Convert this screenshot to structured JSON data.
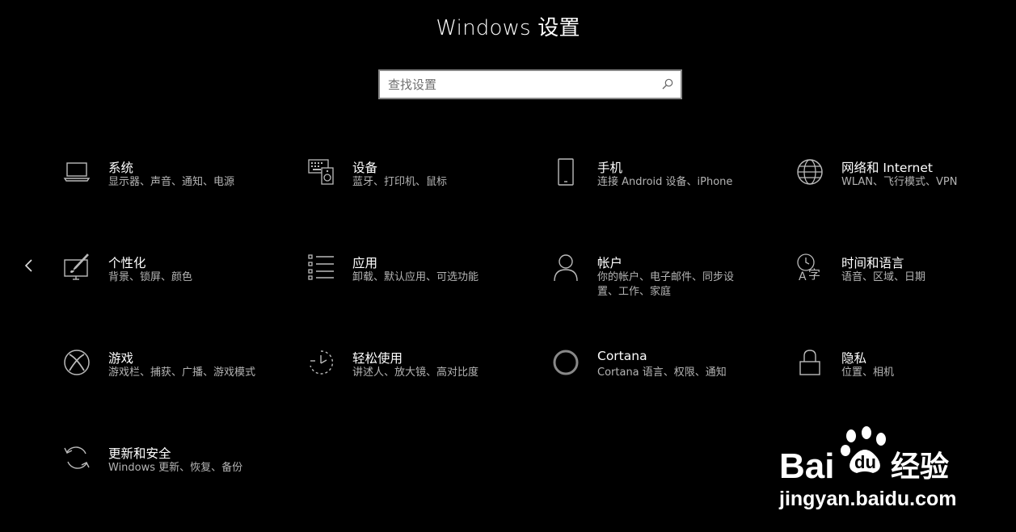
{
  "window": {
    "title": "Windows 设置"
  },
  "search": {
    "placeholder": "查找设置"
  },
  "tiles": [
    {
      "id": "system",
      "label": "系统",
      "desc": "显示器、声音、通知、电源",
      "icon": "laptop-icon"
    },
    {
      "id": "devices",
      "label": "设备",
      "desc": "蓝牙、打印机、鼠标",
      "icon": "keyboard-speaker-icon"
    },
    {
      "id": "phone",
      "label": "手机",
      "desc": "连接 Android 设备、iPhone",
      "icon": "phone-icon"
    },
    {
      "id": "network",
      "label": "网络和 Internet",
      "desc": "WLAN、飞行模式、VPN",
      "icon": "globe-icon"
    },
    {
      "id": "personalization",
      "label": "个性化",
      "desc": "背景、锁屏、颜色",
      "icon": "brush-monitor-icon"
    },
    {
      "id": "apps",
      "label": "应用",
      "desc": "卸载、默认应用、可选功能",
      "icon": "apps-list-icon"
    },
    {
      "id": "accounts",
      "label": "帐户",
      "desc": "你的帐户、电子邮件、同步设置、工作、家庭",
      "icon": "person-icon"
    },
    {
      "id": "time-language",
      "label": "时间和语言",
      "desc": "语音、区域、日期",
      "icon": "time-language-icon"
    },
    {
      "id": "gaming",
      "label": "游戏",
      "desc": "游戏栏、捕获、广播、游戏模式",
      "icon": "xbox-icon"
    },
    {
      "id": "ease-of-access",
      "label": "轻松使用",
      "desc": "讲述人、放大镜、高对比度",
      "icon": "ease-of-access-icon"
    },
    {
      "id": "cortana",
      "label": "Cortana",
      "desc": "Cortana 语言、权限、通知",
      "icon": "cortana-icon"
    },
    {
      "id": "privacy",
      "label": "隐私",
      "desc": "位置、相机",
      "icon": "lock-icon"
    },
    {
      "id": "update-security",
      "label": "更新和安全",
      "desc": "Windows 更新、恢复、备份",
      "icon": "sync-arrows-icon"
    }
  ],
  "watermark": {
    "brand": "Bai",
    "brand2": "du",
    "product": "经验",
    "url": "jingyan.baidu.com"
  }
}
